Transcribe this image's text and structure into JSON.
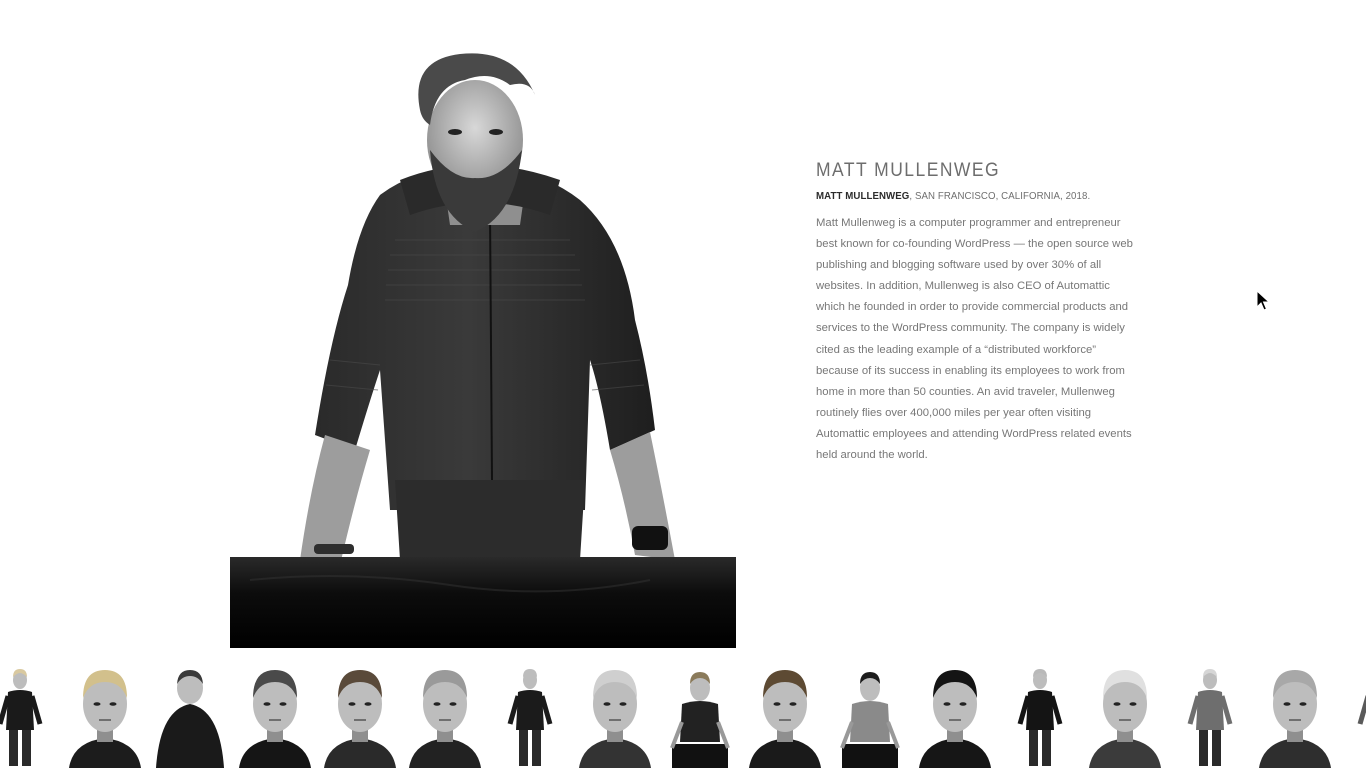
{
  "profile": {
    "title": "MATT MULLENWEG",
    "caption_name": "MATT MULLENWEG",
    "caption_rest": ", SAN FRANCISCO, CALIFORNIA, 2018.",
    "bio": "Matt Mullenweg is a computer programmer and entrepreneur best known for co-founding WordPress — the open source web publishing and blogging software used by over 30% of all websites. In addition, Mullenweg is also CEO of Automattic which he founded in order to provide commercial products and services to the WordPress community. The company is widely cited as the leading example of a “distributed workforce” because of its success in enabling its employees to work from home in more than 50 counties. An avid traveler, Mullenweg routinely flies over 400,000 miles per year often visiting Automattic employees and attending WordPress related events held around the world."
  },
  "colors": {
    "background": "#ffffff",
    "title": "#6d6d6d",
    "text": "#777777",
    "caption_strong": "#2b2b2b"
  },
  "thumbnails": [
    {
      "kind": "full",
      "hair": "#d9c9a0",
      "clothes": "#1a1a1a"
    },
    {
      "kind": "head",
      "hair": "#d2c08c",
      "clothes": "#1c1c1c"
    },
    {
      "kind": "half",
      "hair": "#3a3a3a",
      "clothes": "#1a1a1a"
    },
    {
      "kind": "head",
      "hair": "#4a4a4a",
      "clothes": "#151515"
    },
    {
      "kind": "head",
      "hair": "#5a4a3a",
      "clothes": "#2a2a2a"
    },
    {
      "kind": "head",
      "hair": "#9a9a9a",
      "clothes": "#222222"
    },
    {
      "kind": "full",
      "hair": "#bdbdbd",
      "clothes": "#1b1b1b"
    },
    {
      "kind": "head",
      "hair": "#cfcfcf",
      "clothes": "#333333"
    },
    {
      "kind": "seated",
      "hair": "#8a7a5a",
      "clothes": "#222222"
    },
    {
      "kind": "head",
      "hair": "#5d4a33",
      "clothes": "#1a1a1a"
    },
    {
      "kind": "seated",
      "hair": "#1c1c1c",
      "clothes": "#8a8a8a"
    },
    {
      "kind": "head",
      "hair": "#141414",
      "clothes": "#161616"
    },
    {
      "kind": "full",
      "hair": "#b9b9b9",
      "clothes": "#141414"
    },
    {
      "kind": "head",
      "hair": "#e0e0e0",
      "clothes": "#3b3b3b"
    },
    {
      "kind": "full",
      "hair": "#d6d6d6",
      "clothes": "#6e6e6e"
    },
    {
      "kind": "head",
      "hair": "#a8a8a8",
      "clothes": "#2e2e2e"
    },
    {
      "kind": "full",
      "hair": "#c0c0c0",
      "clothes": "#5a5a5a"
    }
  ]
}
